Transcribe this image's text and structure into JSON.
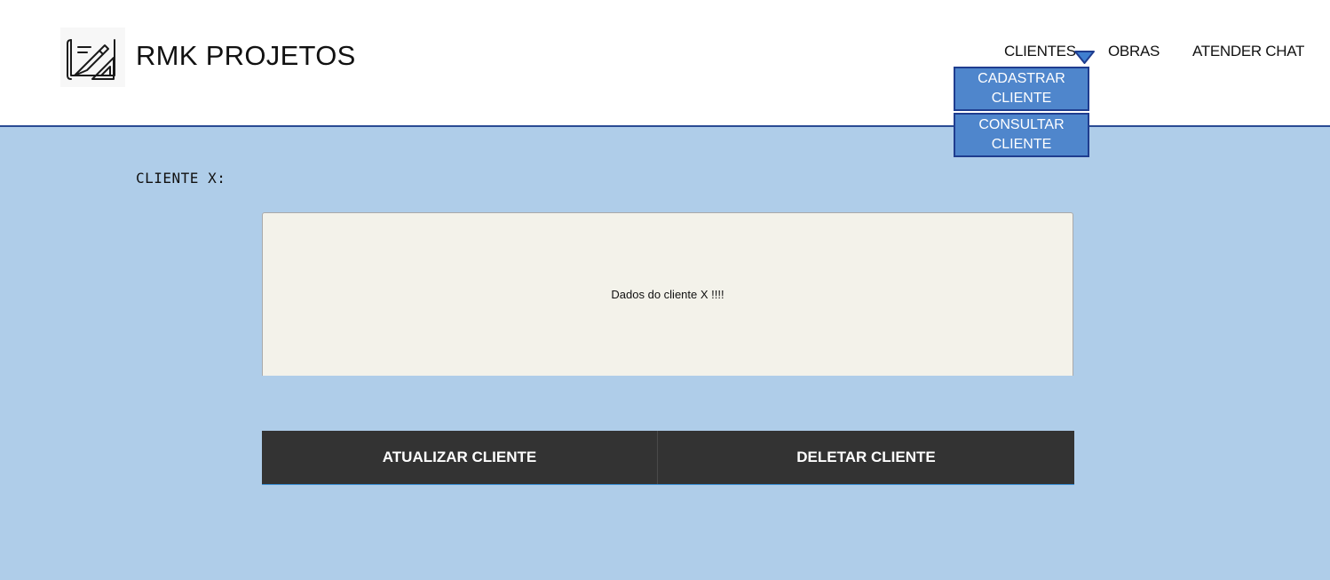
{
  "header": {
    "brand": "RMK PROJETOS",
    "logo_icon": "blueprint-pencil-ruler-icon",
    "nav": {
      "clientes": "CLIENTES",
      "obras": "OBRAS",
      "atender_chat": "ATENDER CHAT"
    },
    "dropdown": {
      "cadastrar": "CADASTRAR CLIENTE",
      "consultar": "CONSULTAR CLIENTE"
    }
  },
  "main": {
    "section_title": "CLIENTE X:",
    "data_text": "Dados do cliente X !!!!",
    "actions": {
      "update": "ATUALIZAR CLIENTE",
      "delete": "DELETAR CLIENTE"
    }
  },
  "colors": {
    "background": "#afcde9",
    "header_border": "#2a4b94",
    "dropdown_bg": "#4f86cc",
    "button_bg": "#333333"
  }
}
